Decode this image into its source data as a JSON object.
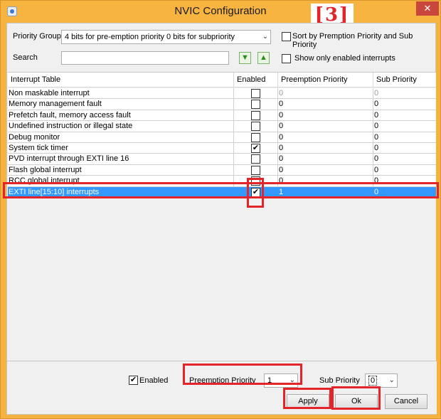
{
  "window": {
    "title": "NVIC Configuration",
    "step_badge": "[3]",
    "close_glyph": "✕"
  },
  "toolbar": {
    "priority_group_label": "Priority Group",
    "priority_group_value": "4 bits for pre-emption priority 0 bits for subpriority",
    "sort_label": "Sort by Premption Priority and Sub Priority",
    "sort_checked": false,
    "search_label": "Search",
    "search_value": "",
    "search_down_icon": "arrow-down-icon",
    "search_up_icon": "arrow-up-icon",
    "only_enabled_label": "Show only enabled interrupts",
    "only_enabled_checked": false
  },
  "table": {
    "columns": [
      "Interrupt Table",
      "Enabled",
      "Preemption Priority",
      "Sub Priority"
    ],
    "rows": [
      {
        "name": "Non maskable interrupt",
        "enabled": false,
        "preemption": "0",
        "sub": "0"
      },
      {
        "name": "Memory management fault",
        "enabled": false,
        "preemption": "0",
        "sub": "0"
      },
      {
        "name": "Prefetch fault, memory access fault",
        "enabled": false,
        "preemption": "0",
        "sub": "0"
      },
      {
        "name": "Undefined instruction or illegal state",
        "enabled": false,
        "preemption": "0",
        "sub": "0"
      },
      {
        "name": "Debug monitor",
        "enabled": false,
        "preemption": "0",
        "sub": "0"
      },
      {
        "name": "System tick timer",
        "enabled": true,
        "preemption": "0",
        "sub": "0"
      },
      {
        "name": "PVD interrupt through EXTI line 16",
        "enabled": false,
        "preemption": "0",
        "sub": "0"
      },
      {
        "name": "Flash global interrupt",
        "enabled": false,
        "preemption": "0",
        "sub": "0"
      },
      {
        "name": "RCC global interrupt",
        "enabled": false,
        "preemption": "0",
        "sub": "0"
      },
      {
        "name": "EXTI line[15:10] interrupts",
        "enabled": true,
        "preemption": "1",
        "sub": "0"
      }
    ],
    "selected_index": 9
  },
  "footer": {
    "enabled_label": "Enabled",
    "enabled_checked": true,
    "preemption_label": "Preemption Priority",
    "preemption_value": "1",
    "sub_label": "Sub Priority",
    "sub_value": "0",
    "apply_label": "Apply",
    "ok_label": "Ok",
    "cancel_label": "Cancel"
  },
  "colors": {
    "title_bar": "#f7b441",
    "selection": "#3399ff",
    "highlight": "#e3242b"
  }
}
